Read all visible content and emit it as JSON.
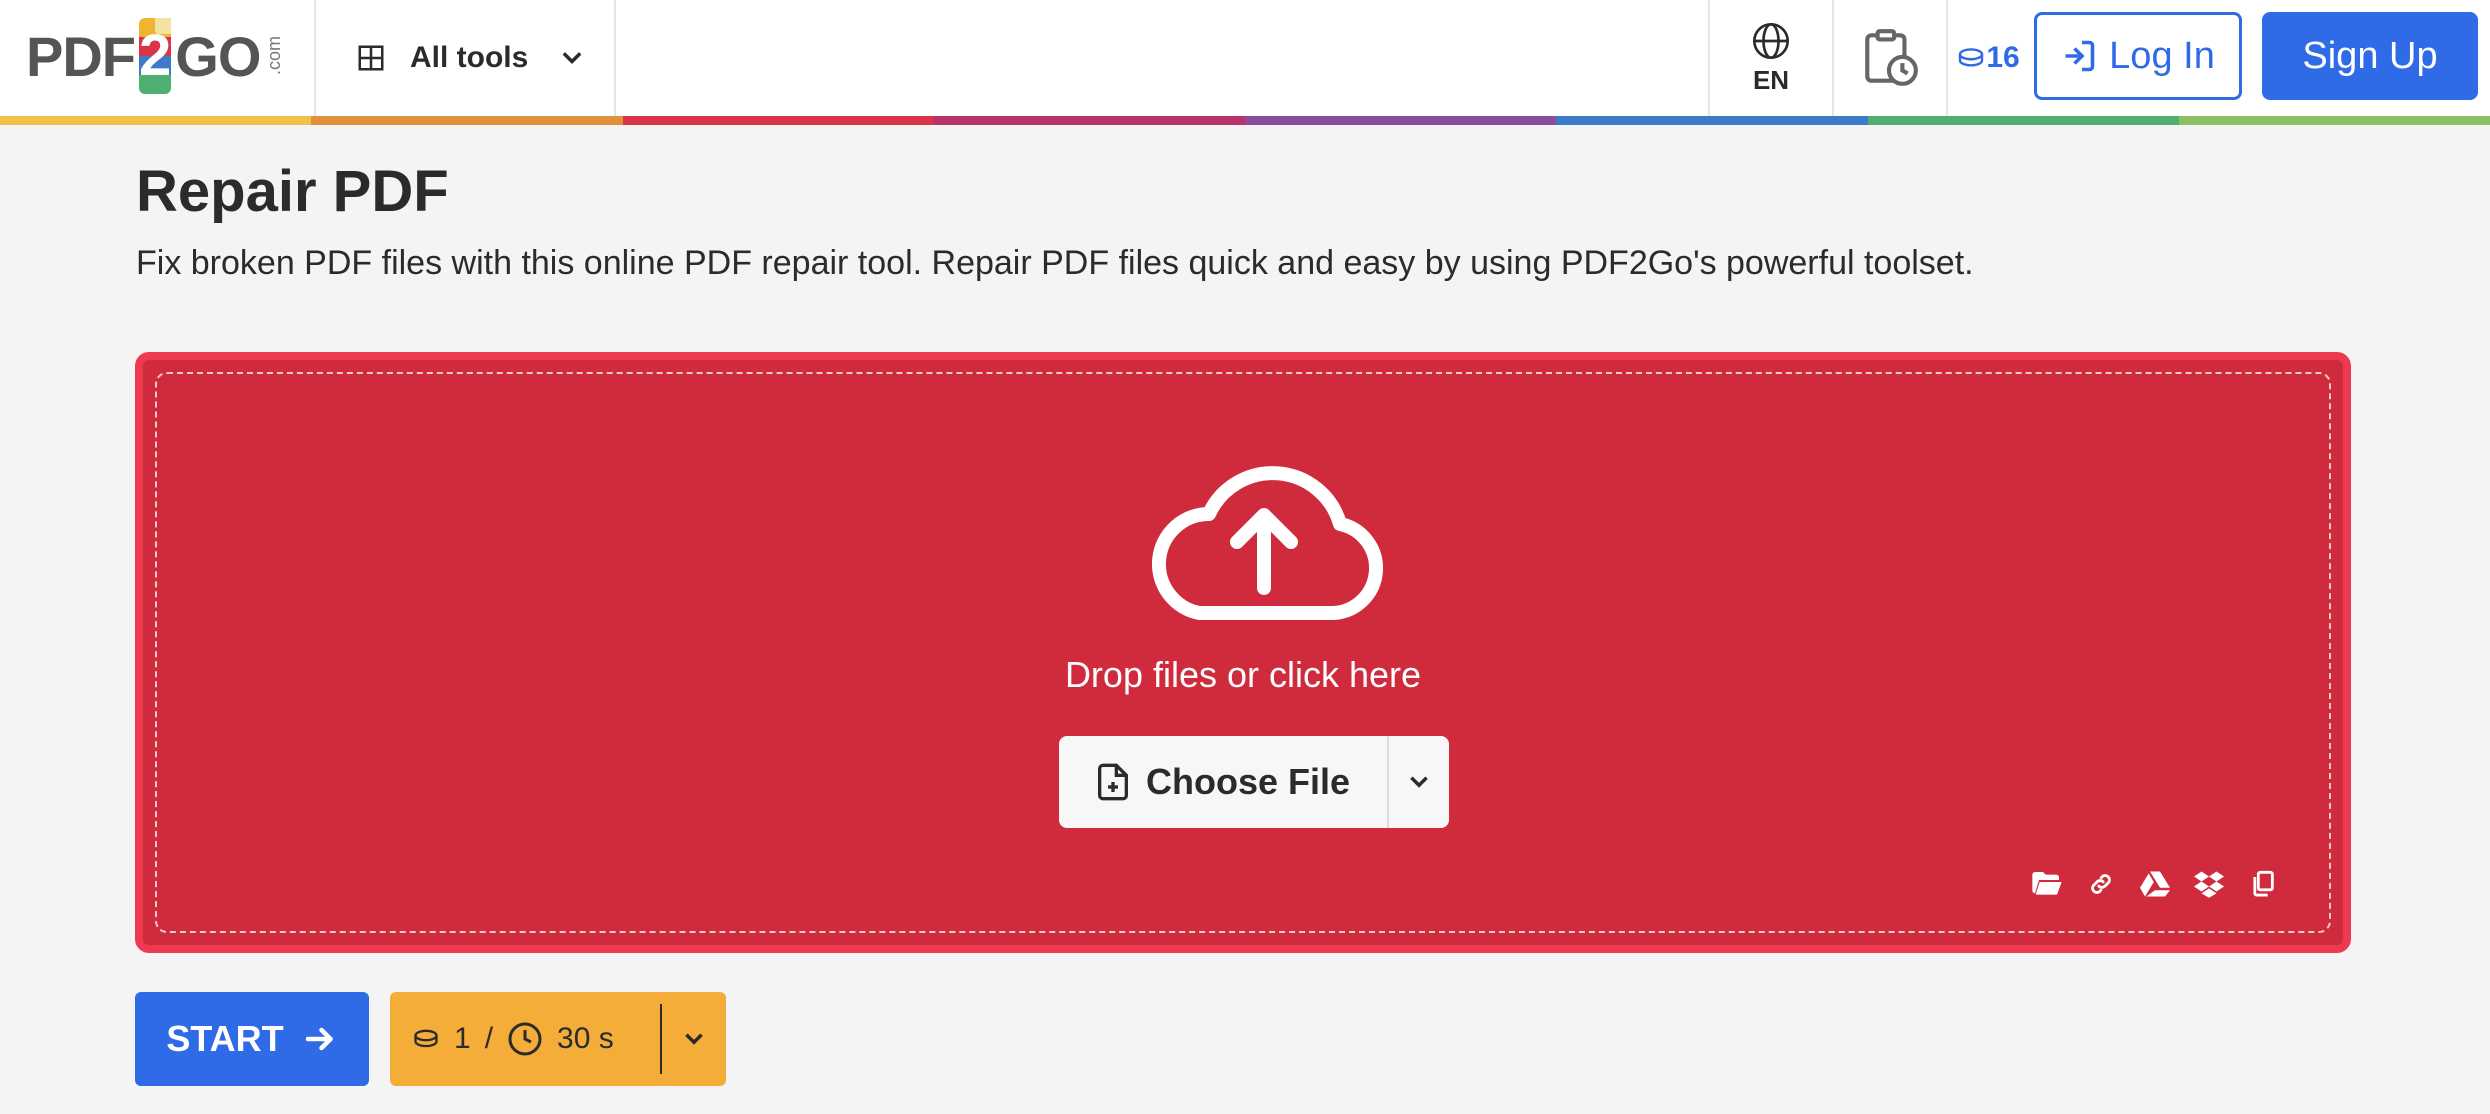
{
  "header": {
    "logo": {
      "left": "PDF",
      "middle": "2",
      "right": "GO",
      "suffix": ".com"
    },
    "all_tools_label": "All tools",
    "language": "EN",
    "credits": "16",
    "login_label": "Log In",
    "signup_label": "Sign Up"
  },
  "colors": {
    "accent": "#2f6be6",
    "dropzone_bg": "#cf2b3d",
    "dropzone_border": "#ee3a50",
    "cost_bg": "#f5ad3a",
    "stripe": [
      "#f0c24a",
      "#e0913a",
      "#d9344a",
      "#b8336a",
      "#8a4d9c",
      "#3d7ac8",
      "#4fae72",
      "#8cc063"
    ]
  },
  "main": {
    "title": "Repair PDF",
    "subtitle": "Fix broken PDF files with this online PDF repair tool. Repair PDF files quick and easy by using PDF2Go's powerful toolset.",
    "dropzone": {
      "prompt": "Drop files or click here",
      "choose_label": "Choose File",
      "sources": [
        "folder-icon",
        "link-icon",
        "google-drive-icon",
        "dropbox-icon",
        "clipboard-icon"
      ]
    }
  },
  "actions": {
    "start_label": "START",
    "cost_credits": "1",
    "cost_separator": "/",
    "cost_time": "30 s"
  }
}
